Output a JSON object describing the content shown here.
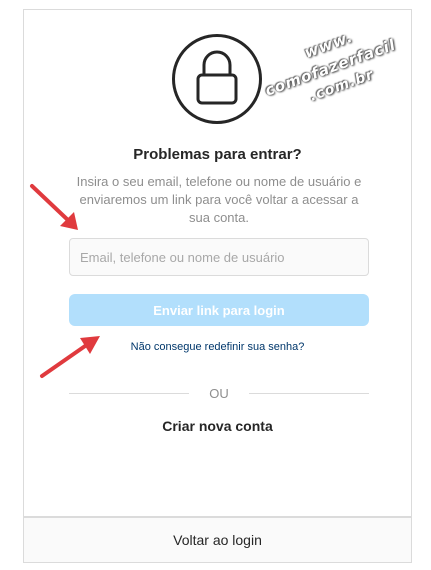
{
  "colors": {
    "primary_disabled": "#b2dffc",
    "link": "#00376b",
    "border": "#dbdbdb",
    "annotation_arrow": "#e03a3e"
  },
  "watermark": {
    "line1": "www.",
    "line2": "comofazerfacil",
    "line3": ".com.br"
  },
  "header": {
    "icon": "lock-icon",
    "title": "Problemas para entrar?",
    "description": "Insira o seu email, telefone ou nome de usuário e enviaremos um link para você voltar a acessar a sua conta."
  },
  "form": {
    "input_value": "",
    "input_placeholder": "Email, telefone ou nome de usuário",
    "send_button": "Enviar link para login",
    "reset_link": "Não consegue redefinir sua senha?"
  },
  "divider": {
    "label": "OU"
  },
  "create_account": "Criar nova conta",
  "footer": {
    "back_to_login": "Voltar ao login"
  }
}
